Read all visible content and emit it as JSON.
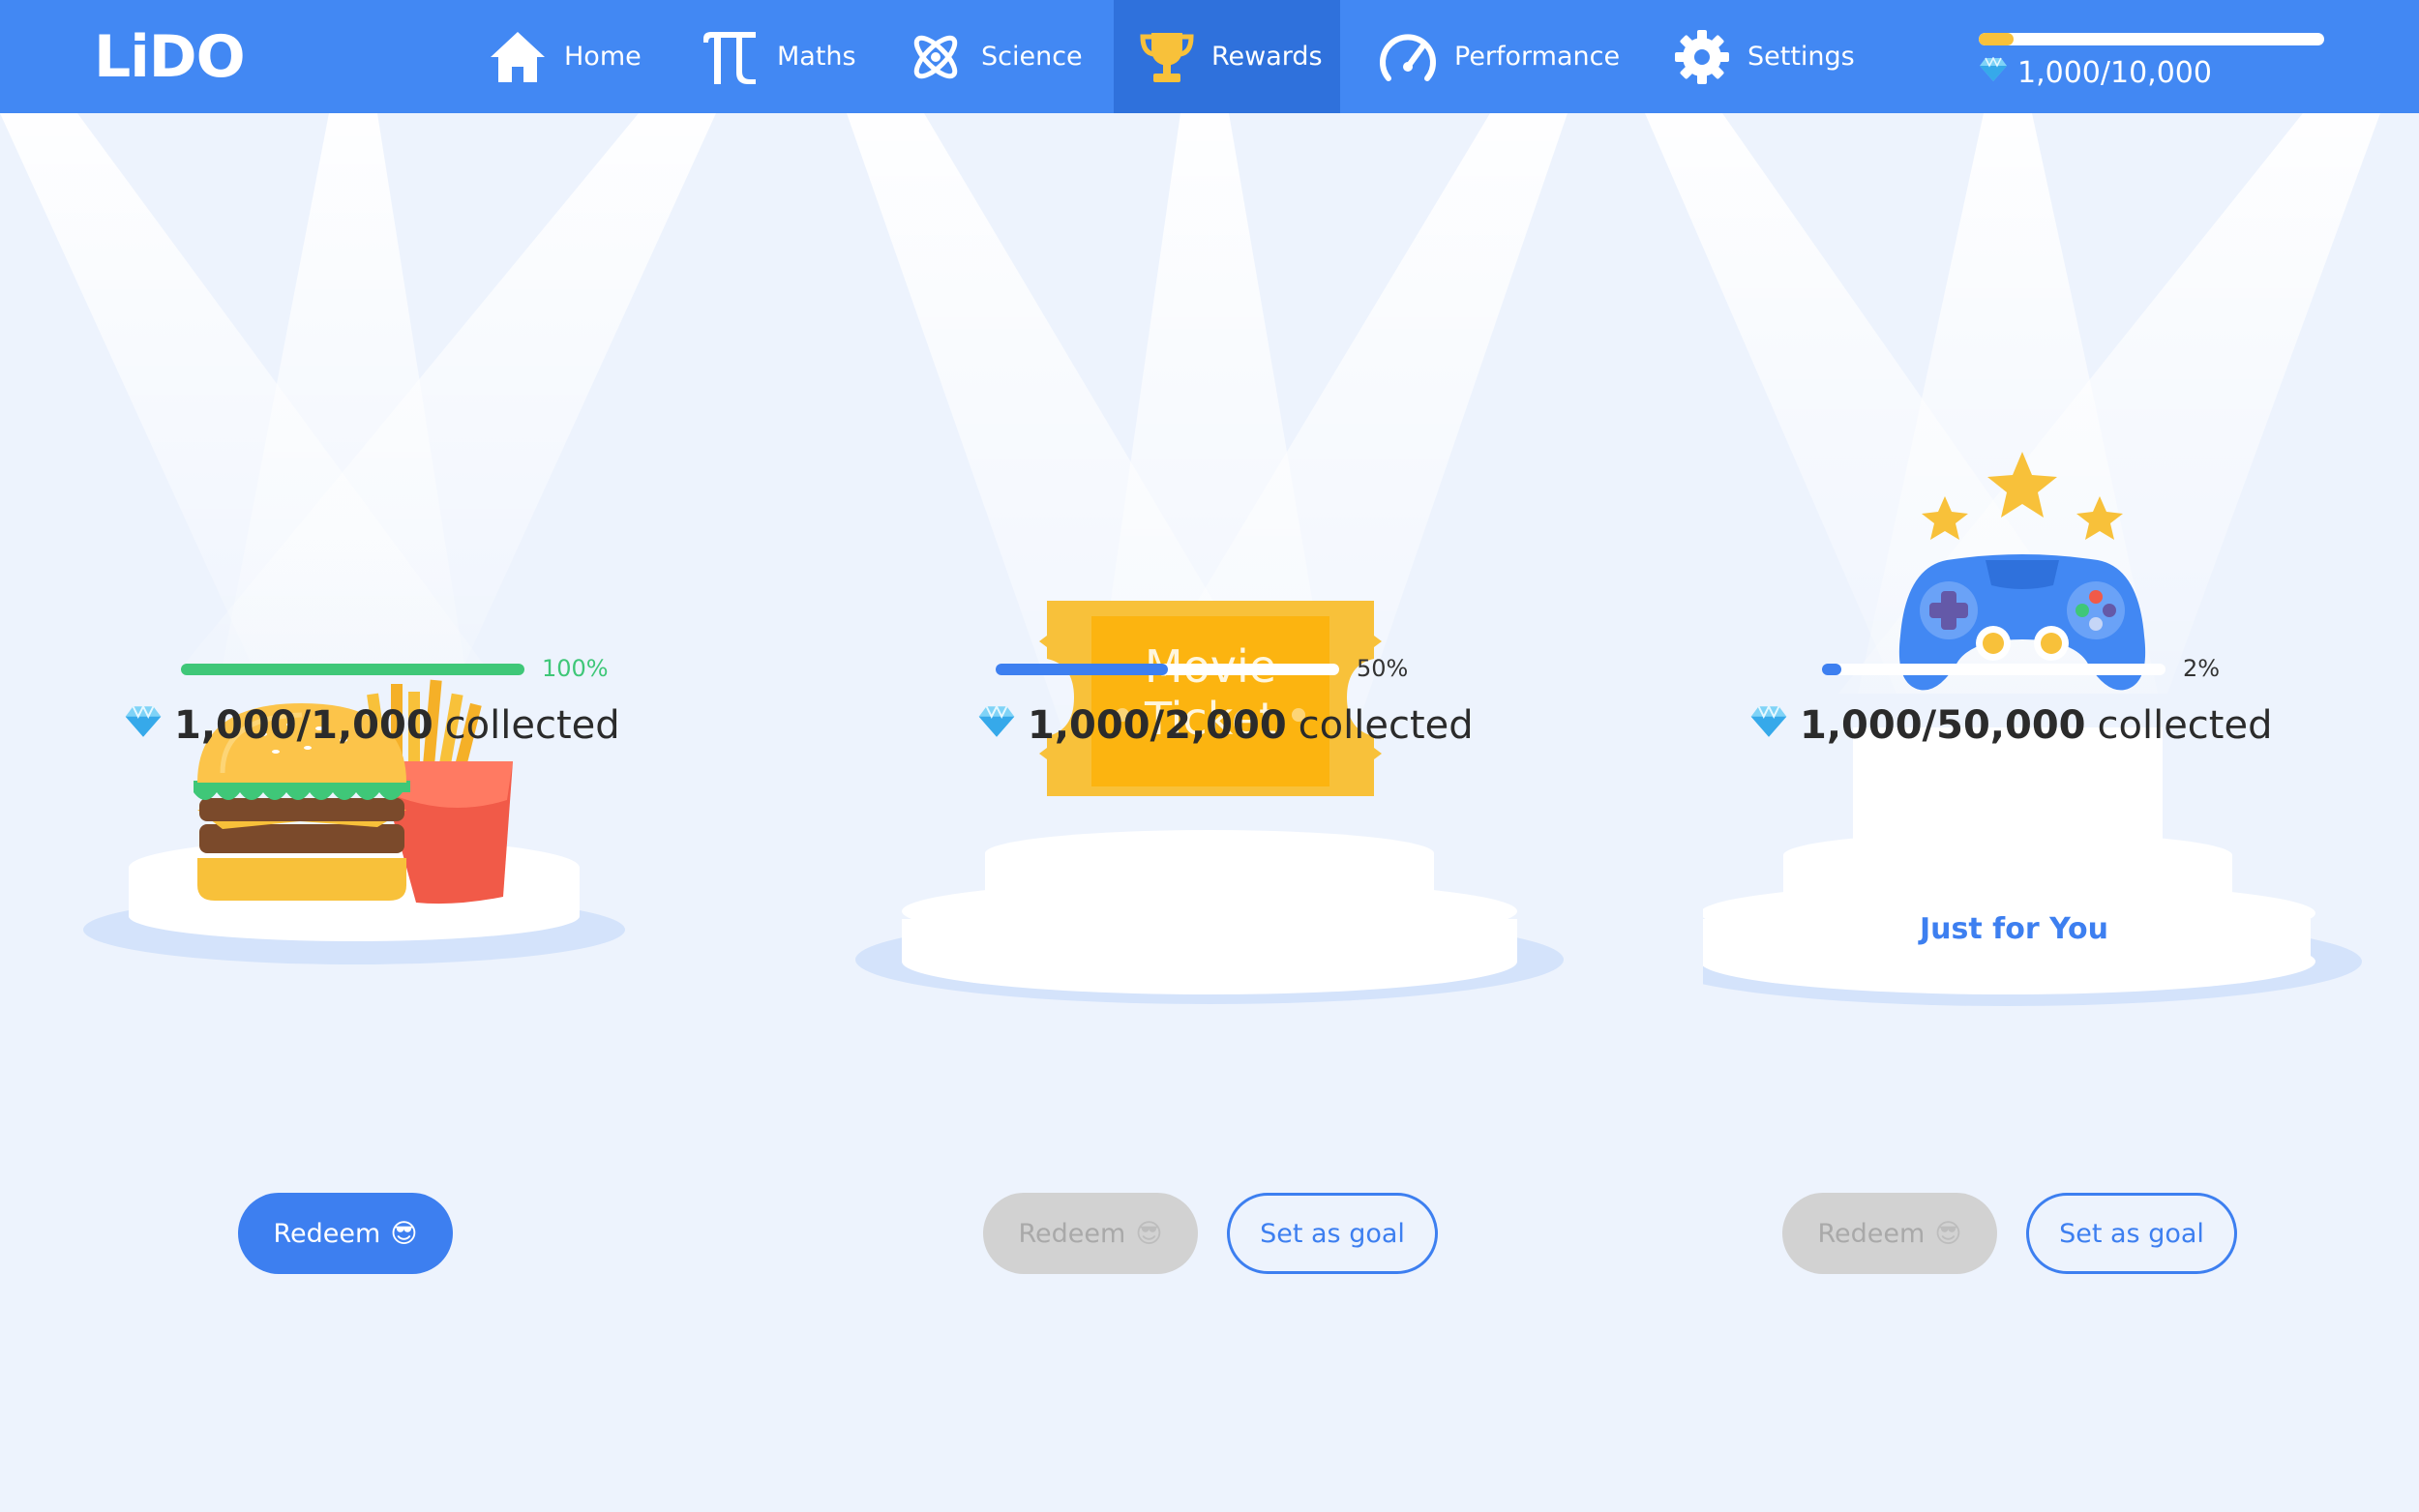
{
  "app": {
    "logo_text": "LiDO",
    "nav": [
      {
        "label": "Home",
        "icon": "home-icon"
      },
      {
        "label": "Maths",
        "icon": "pi-icon"
      },
      {
        "label": "Science",
        "icon": "atom-icon"
      },
      {
        "label": "Rewards",
        "icon": "trophy-icon",
        "active": true
      },
      {
        "label": "Performance",
        "icon": "speedometer-icon"
      },
      {
        "label": "Settings",
        "icon": "gear-icon"
      }
    ],
    "gems": {
      "text": "1,000/10,000",
      "progress": 0.1,
      "icon": "gem-icon"
    }
  },
  "colors": {
    "nav_bg": "#4288f3",
    "nav_active": "#2f71dc",
    "accent": "#3d7ff0",
    "green": "#3fc778",
    "yellow": "#f8c13a",
    "page_bg": "#edf3fd"
  },
  "rewards": [
    {
      "item": "burger-and-fries",
      "percent_text": "100%",
      "progress": 1.0,
      "collected_value": "1,000/1,000",
      "collected_label": "collected",
      "redeem_label": "Redeem",
      "redeem_emoji": "😎",
      "redeem_enabled": true
    },
    {
      "item": "movie-ticket",
      "ticket_line1": "Movie",
      "ticket_line2": "Ticket",
      "percent_text": "50%",
      "progress": 0.5,
      "collected_value": "1,000/2,000",
      "collected_label": "collected",
      "redeem_label": "Redeem",
      "redeem_emoji": "😎",
      "redeem_enabled": false,
      "goal_label": "Set as goal"
    },
    {
      "item": "game-controller",
      "tag": "Just for You",
      "percent_text": "2%",
      "progress": 0.02,
      "collected_value": "1,000/50,000",
      "collected_label": "collected",
      "redeem_label": "Redeem",
      "redeem_emoji": "😎",
      "redeem_enabled": false,
      "goal_label": "Set as goal"
    }
  ]
}
